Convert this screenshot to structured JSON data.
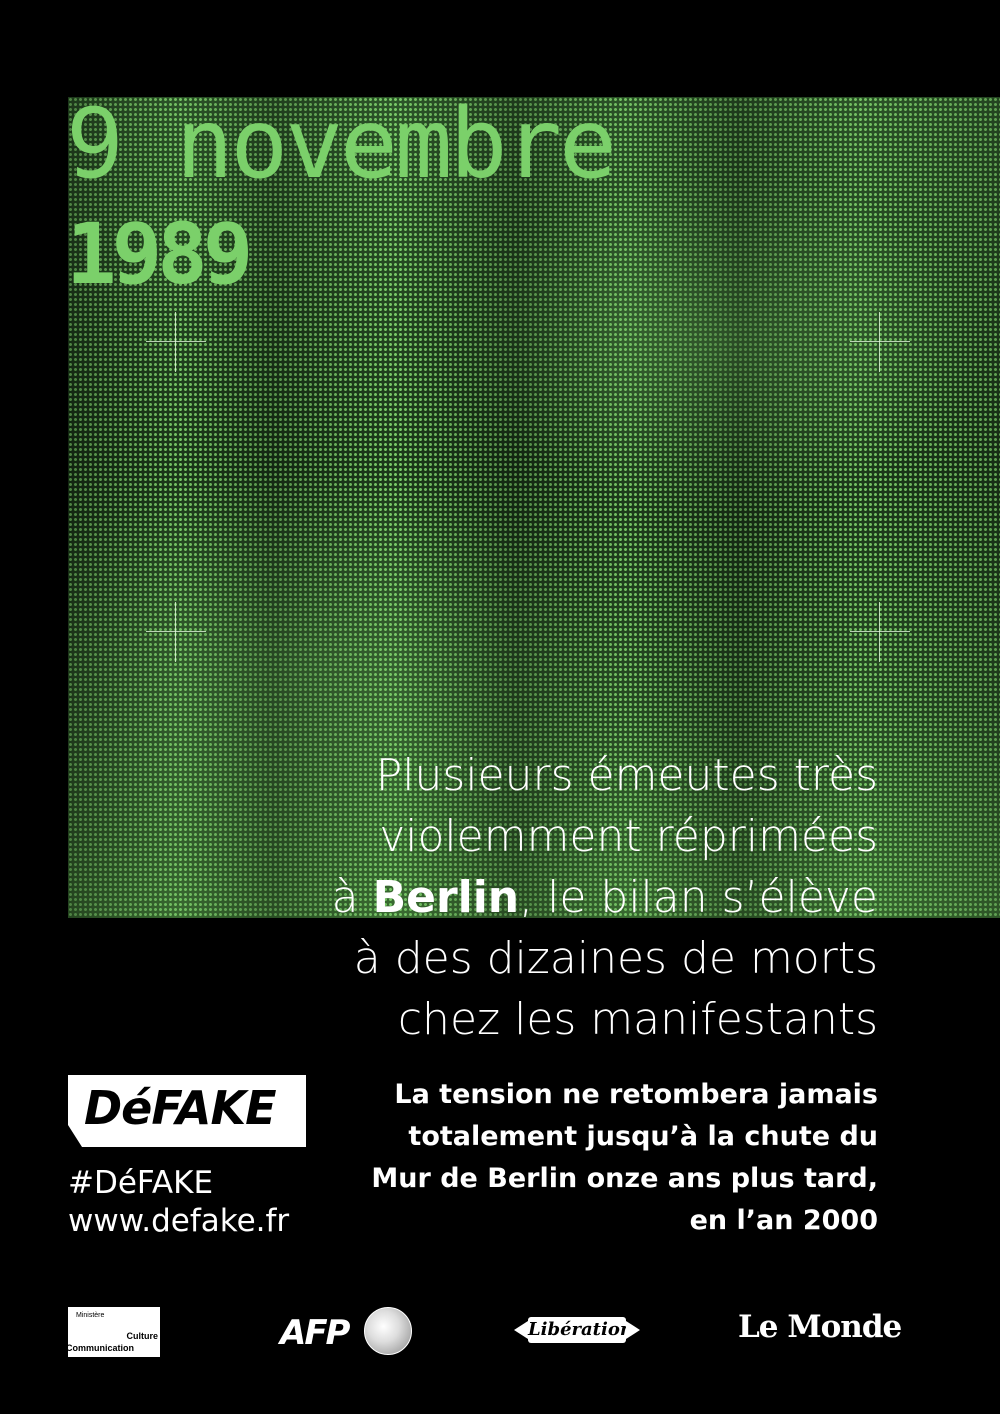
{
  "poster": {
    "date": "9 novembre",
    "year": "1989",
    "headline": {
      "line1": "Plusieurs émeutes très",
      "line2": "violemment réprimées",
      "line3_prefix": "à ",
      "line3_bold": "Berlin",
      "line3_suffix": ", le bilan s’élève",
      "line4": "à des dizaines de morts",
      "line5": "chez les manifestants"
    },
    "subtext": [
      "La tension ne retombera jamais",
      "totalement jusqu’à la chute du",
      "Mur de Berlin onze ans plus tard,",
      "en l’an 2000"
    ]
  },
  "brand": {
    "logo": "DéFAKE",
    "hashtag": "#DéFAKE",
    "website": "www.defake.fr"
  },
  "partners": {
    "ministry": {
      "line1": "Ministère",
      "line2": "Culture",
      "line3": "Communication"
    },
    "afp": "AFP",
    "liberation": "Libération",
    "lemonde": "Le Monde"
  },
  "colors": {
    "background": "#000000",
    "accent_green": "#7bd06a",
    "text": "#ffffff"
  },
  "icons": [
    "crosshair-icon",
    "afp-globe-icon",
    "liberation-arrow-icon"
  ]
}
